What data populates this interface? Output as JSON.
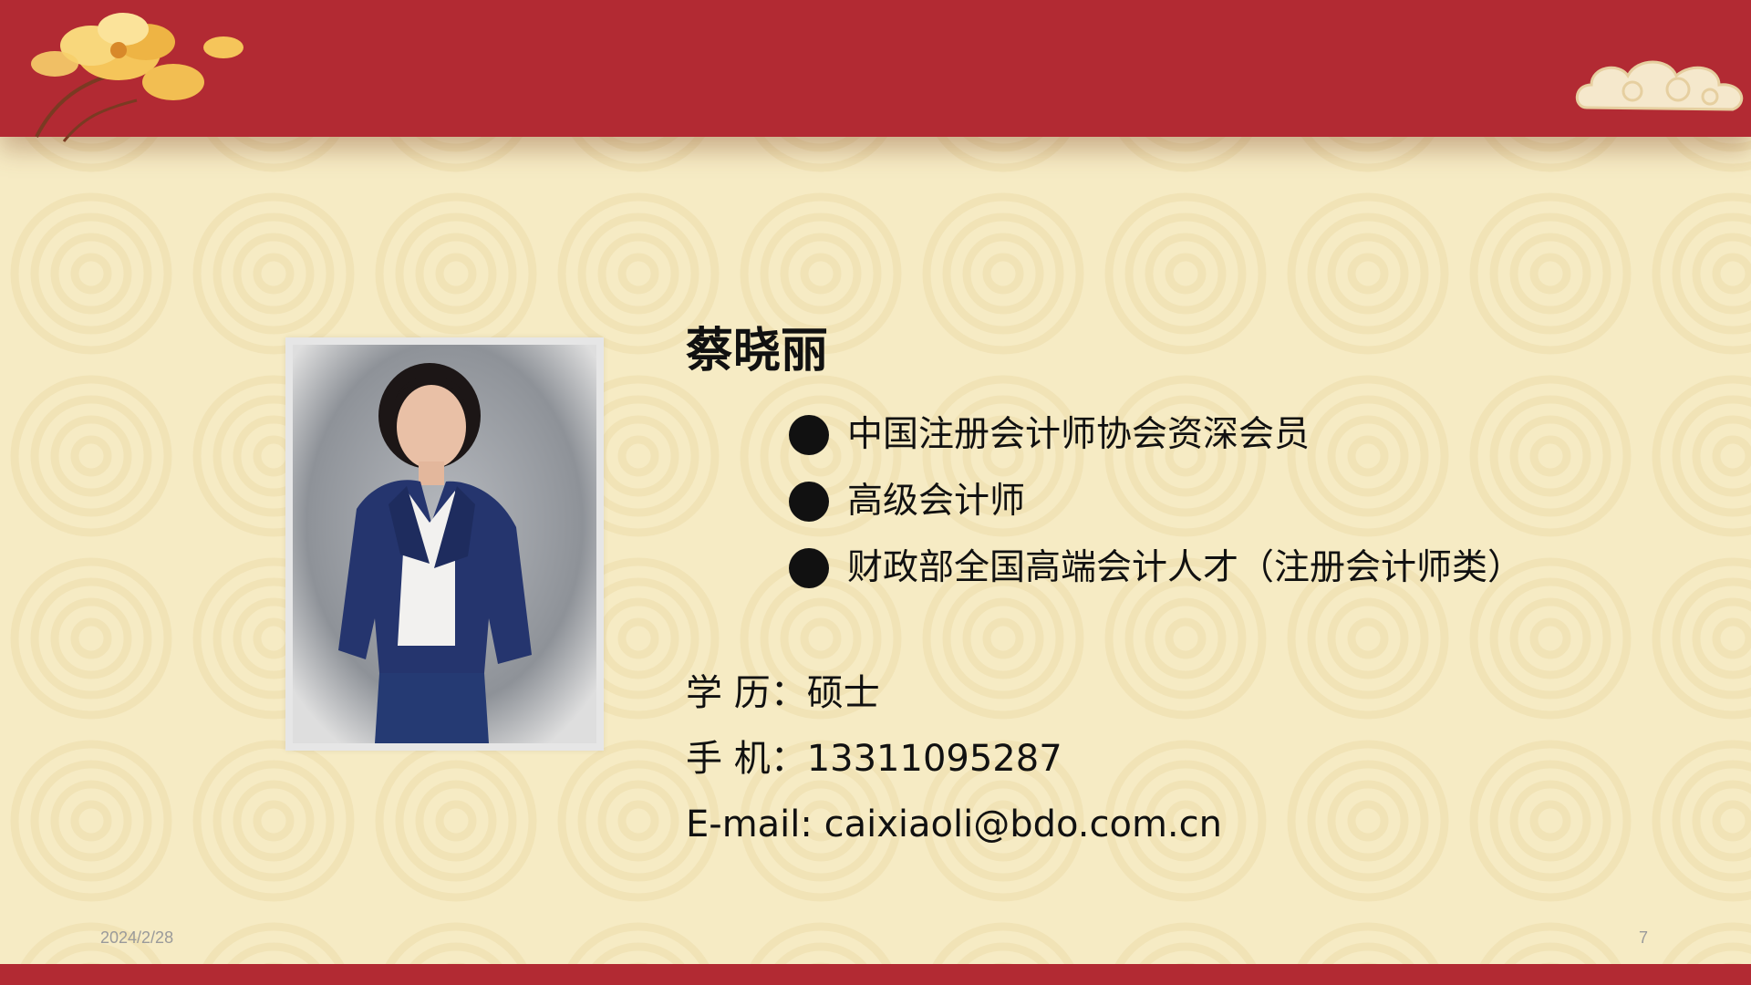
{
  "slide": {
    "name": "蔡晓丽",
    "bullets": [
      "中国注册会计师协会资深会员",
      "高级会计师",
      "财政部全国高端会计人才（注册会计师类）"
    ],
    "education": "学 历：硕士",
    "phone": "手 机：13311095287",
    "email": "E-mail: caixiaoli@bdo.com.cn"
  },
  "footer": {
    "date": "2024/2/28",
    "page_number": "7"
  },
  "colors": {
    "band_red": "#b22a33",
    "background_cream": "#f6ebc4"
  },
  "icons": {
    "top_left": "flower-icon",
    "top_right": "cloud-icon",
    "bullet": "bullet-dot-icon"
  }
}
